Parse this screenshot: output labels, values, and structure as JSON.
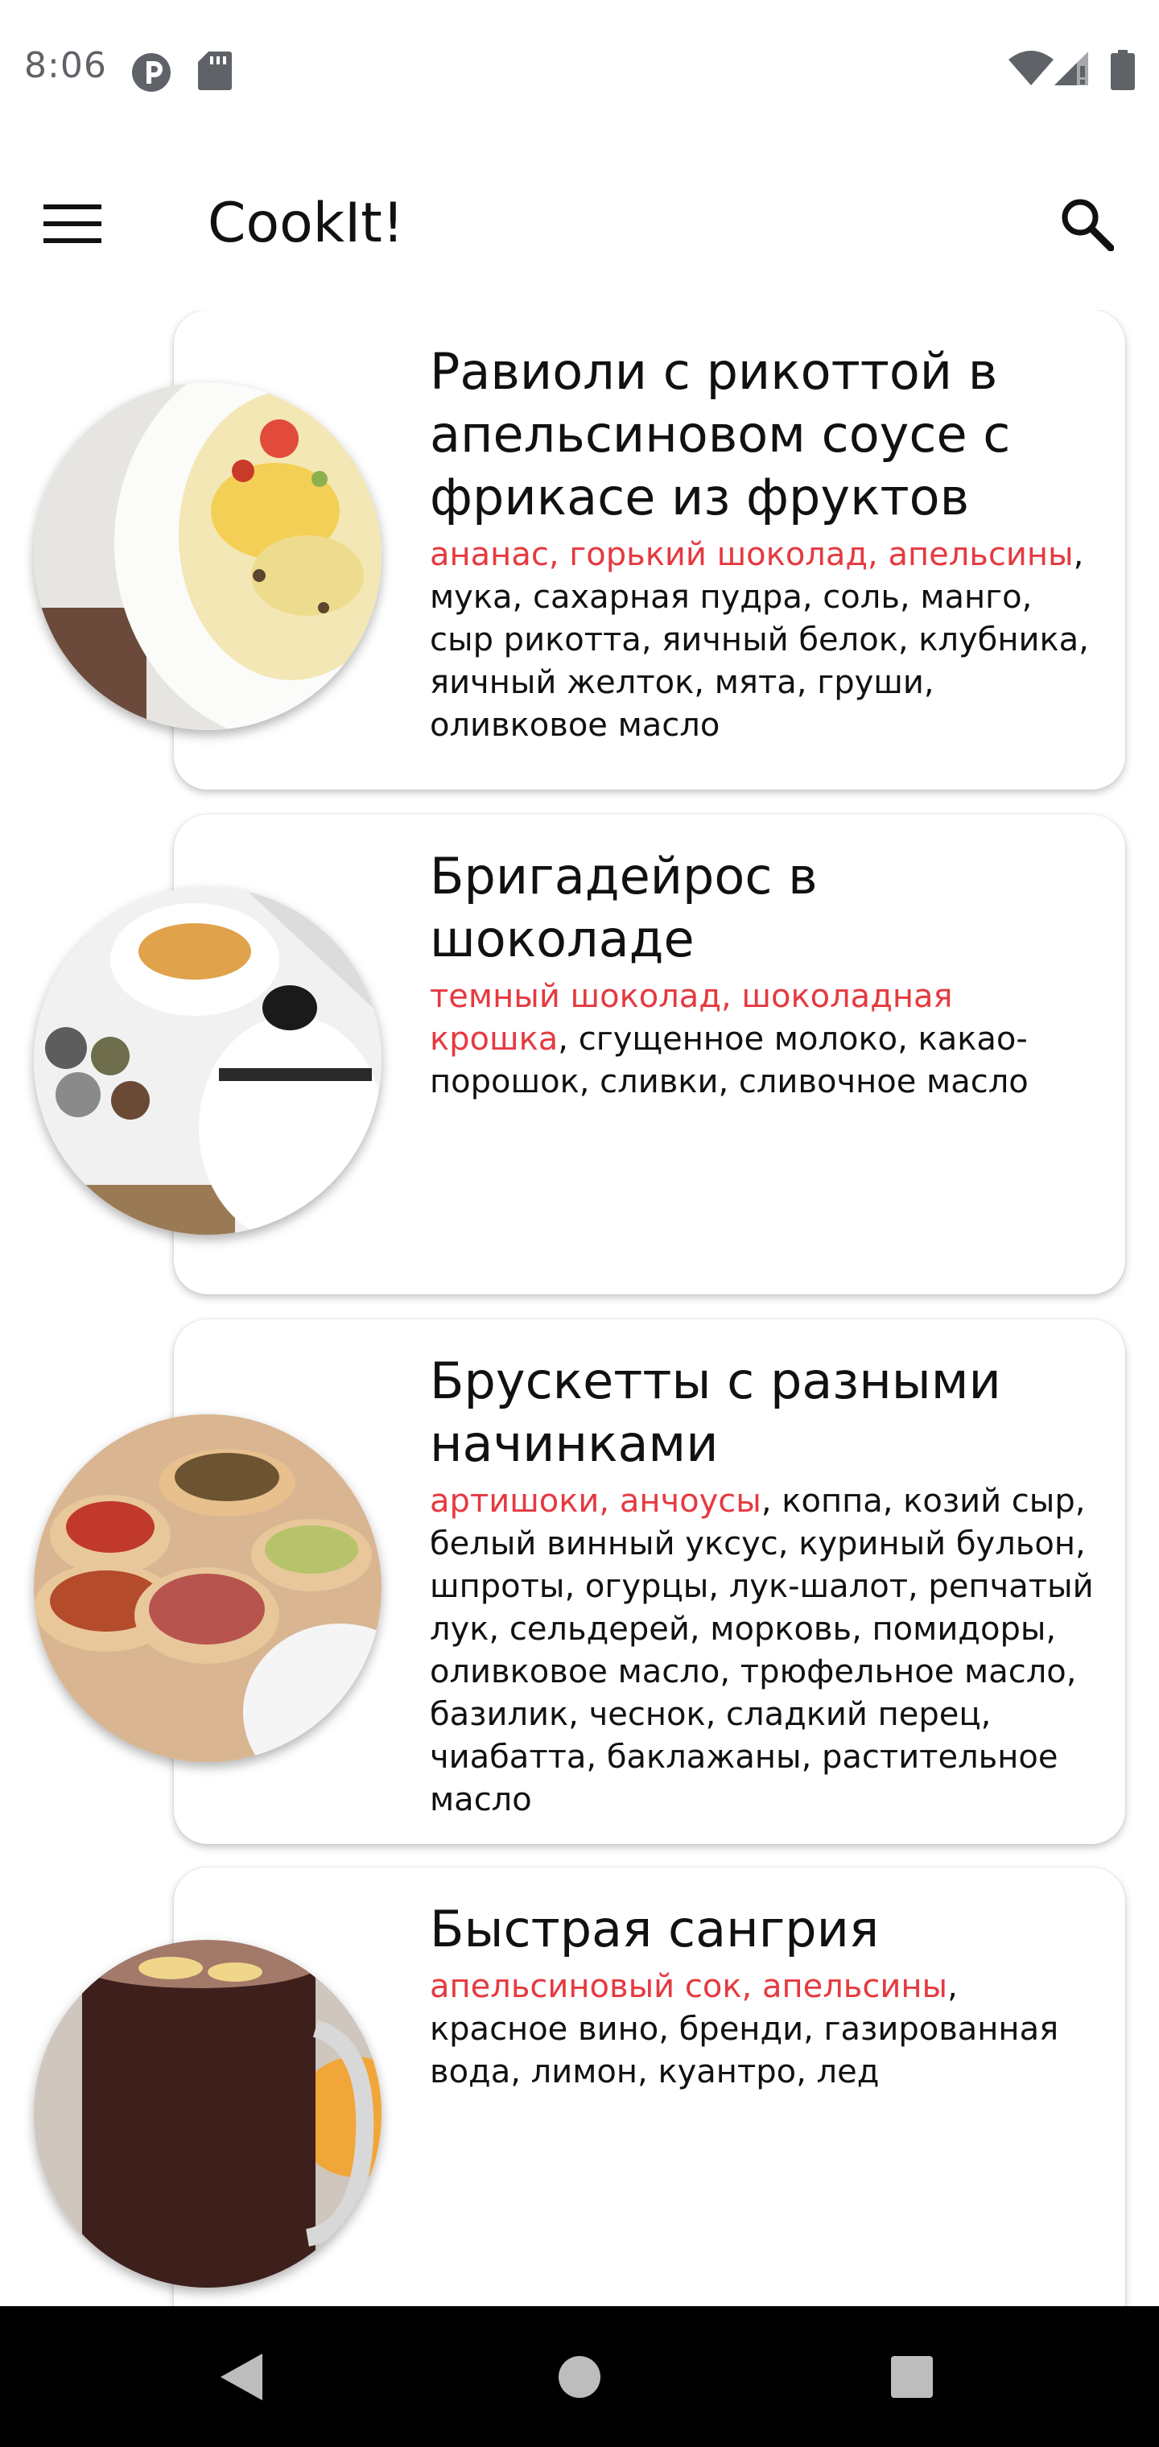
{
  "status_bar": {
    "time": "8:06",
    "icons": [
      "privacy-indicator-icon",
      "sd-card-icon",
      "wifi-icon",
      "cellular-signal-icon",
      "battery-icon"
    ]
  },
  "app_bar": {
    "title": "CookIt!",
    "menu_icon": "hamburger-menu-icon",
    "search_icon": "search-icon"
  },
  "accent_color": "#e53a40",
  "recipes": [
    {
      "title": "Равиоли с рикоттой в апельсиновом соусе с фрикасе из фруктов",
      "main_ingredients": "ананас, горький шоколад, апельсины",
      "other_ingredients": ", мука, сахарная пудра, соль, манго, сыр рикотта, яичный белок, клубника, яичный желток, мята, груши, оливковое масло"
    },
    {
      "title": "Бригадейрос в шоколаде",
      "main_ingredients": "темный шоколад, шоколадная крошка",
      "other_ingredients": ", сгущенное молоко, какао-порошок, сливки, сливочное масло"
    },
    {
      "title": "Брускетты с разными начинками",
      "main_ingredients": "артишоки, анчоусы",
      "other_ingredients": ", коппа, козий сыр, белый винный уксус, куриный бульон, шпроты, огурцы, лук-шалот, репчатый лук, сельдерей, морковь, помидоры, оливковое масло, трюфельное масло, базилик, чеснок, сладкий перец, чиабатта, баклажаны, растительное масло"
    },
    {
      "title": "Быстрая сангрия",
      "main_ingredients": "апельсиновый сок, апельсины",
      "other_ingredients": ", красное вино, бренди, газированная вода, лимон, куантро, лед"
    }
  ],
  "nav_bar": {
    "icons": [
      "back-icon",
      "home-icon",
      "recents-icon"
    ]
  }
}
